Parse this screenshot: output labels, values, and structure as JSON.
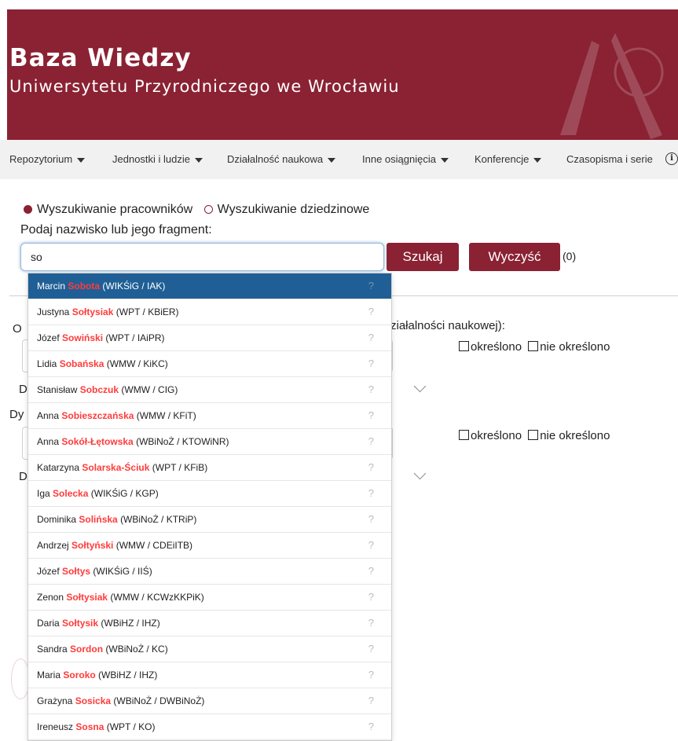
{
  "header": {
    "title": "Baza Wiedzy",
    "subtitle": "Uniwersytetu Przyrodniczego we Wrocławiu"
  },
  "nav": {
    "items": [
      {
        "label": "Repozytorium",
        "dropdown": true
      },
      {
        "label": "Jednostki i ludzie",
        "dropdown": true
      },
      {
        "label": "Działalność naukowa",
        "dropdown": true
      },
      {
        "label": "Inne osiągnięcia",
        "dropdown": true
      },
      {
        "label": "Konferencje",
        "dropdown": true
      },
      {
        "label": "Czasopisma i serie",
        "dropdown": false
      }
    ],
    "info_icon": "info-icon"
  },
  "search": {
    "mode_employees": "Wyszukiwanie pracowników",
    "mode_fields": "Wyszukiwanie dziedzinowe",
    "selected_mode": "employees",
    "prompt": "Podaj nazwisko lub jego fragment:",
    "value": "so",
    "search_button": "Szukaj",
    "clear_button": "Wyczyść",
    "result_count": "(0)"
  },
  "background": {
    "frag_o": "O",
    "frag_activity": "ziałalności naukowej):",
    "frag_d1": "D",
    "frag_dy": "Dy",
    "frag_d2": "D",
    "checkbox_defined": "określono",
    "checkbox_undefined": "nie określono"
  },
  "colors": {
    "brand": "#8a2233",
    "active_row": "#1f5f95",
    "highlight": "#ff3b3b"
  },
  "suggestions": [
    {
      "first": "Marcin",
      "last": "Sobota",
      "unit": "(WIKŚiG / IAK)",
      "active": true
    },
    {
      "first": "Justyna",
      "last": "Sołtysiak",
      "unit": "(WPT / KBiER)"
    },
    {
      "first": "Józef",
      "last": "Sowiński",
      "unit": "(WPT / IAiPR)"
    },
    {
      "first": "Lidia",
      "last": "Sobańska",
      "unit": "(WMW / KiKC)"
    },
    {
      "first": "Stanisław",
      "last": "Sobczuk",
      "unit": "(WMW / CIG)"
    },
    {
      "first": "Anna",
      "last": "Sobieszczańska",
      "unit": "(WMW / KFiT)"
    },
    {
      "first": "Anna",
      "last": "Sokół-Łętowska",
      "unit": "(WBiNoŻ / KTOWiNR)"
    },
    {
      "first": "Katarzyna",
      "last": "Solarska-Ściuk",
      "unit": "(WPT / KFiB)"
    },
    {
      "first": "Iga",
      "last": "Solecka",
      "unit": "(WIKŚiG / KGP)"
    },
    {
      "first": "Dominika",
      "last": "Solińska",
      "unit": "(WBiNoŻ / KTRiP)"
    },
    {
      "first": "Andrzej",
      "last": "Sołtyński",
      "unit": "(WMW / CDEiITB)"
    },
    {
      "first": "Józef",
      "last": "Sołtys",
      "unit": "(WIKŚiG / IIŚ)"
    },
    {
      "first": "Zenon",
      "last": "Sołtysiak",
      "unit": "(WMW / KCWzKKPiK)"
    },
    {
      "first": "Daria",
      "last": "Sołtysik",
      "unit": "(WBiHZ / IHZ)"
    },
    {
      "first": "Sandra",
      "last": "Sordon",
      "unit": "(WBiNoŻ / KC)"
    },
    {
      "first": "Maria",
      "last": "Soroko",
      "unit": "(WBiHZ / IHZ)"
    },
    {
      "first": "Grażyna",
      "last": "Sosicka",
      "unit": "(WBiNoŻ / DWBiNoŻ)"
    },
    {
      "first": "Ireneusz",
      "last": "Sosna",
      "unit": "(WPT / KO)"
    }
  ],
  "suggestion_help": "?"
}
